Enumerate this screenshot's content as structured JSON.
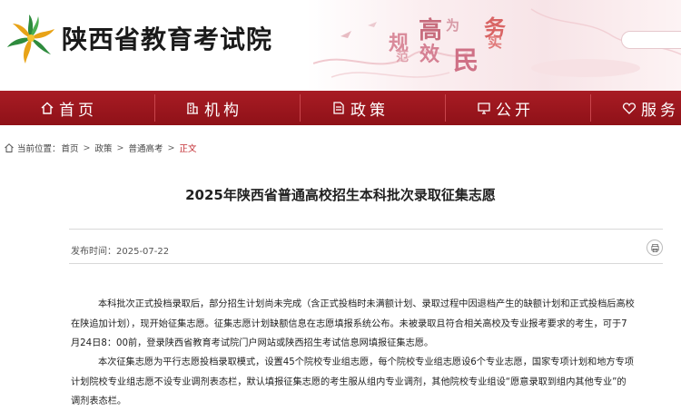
{
  "header": {
    "site_title": "陕西省教育考试院",
    "slogan": [
      "规",
      "高",
      "为",
      "务",
      "范",
      "效",
      "民",
      "实"
    ]
  },
  "nav": {
    "items": [
      {
        "label": "首页",
        "icon": "home-icon"
      },
      {
        "label": "机构",
        "icon": "building-icon"
      },
      {
        "label": "政策",
        "icon": "document-icon"
      },
      {
        "label": "公开",
        "icon": "monitor-icon"
      },
      {
        "label": "服务",
        "icon": "heart-hands-icon"
      }
    ]
  },
  "breadcrumb": {
    "prefix": "当前位置：",
    "items": [
      "首页",
      "政策",
      "普通高考",
      "正文"
    ]
  },
  "article": {
    "title": "2025年陕西省普通高校招生本科批次录取征集志愿",
    "publish_label": "发布时间：",
    "publish_date": "2025-07-22",
    "para1": [
      "本科批次正式投档录取后，部分招生计划尚未完成（含正式投档时未满额计划、录取过程中因退档产生的缺额计划和正式投档后高校",
      "在陕追加计划），现开始征集志愿。征集志愿计划缺额信息在志愿填报系统公布。未被录取且符合相关高校及专业报考要求的考生，可于7",
      "月24日8：00前，登录陕西省教育考试院门户网站或陕西招生考试信息网填报征集志愿。"
    ],
    "para2": [
      "本次征集志愿为平行志愿投档录取模式，设置45个院校专业组志愿，每个院校专业组志愿设6个专业志愿，国家专项计划和地方专项",
      "计划院校专业组志愿不设专业调剂表态栏，默认填报征集志愿的考生服从组内专业调剂，其他院校专业组设“愿意录取到组内其他专业”的",
      "调剂表态栏。"
    ]
  },
  "colors": {
    "nav_red": "#9c161e",
    "crumb_current": "#c1272d"
  }
}
